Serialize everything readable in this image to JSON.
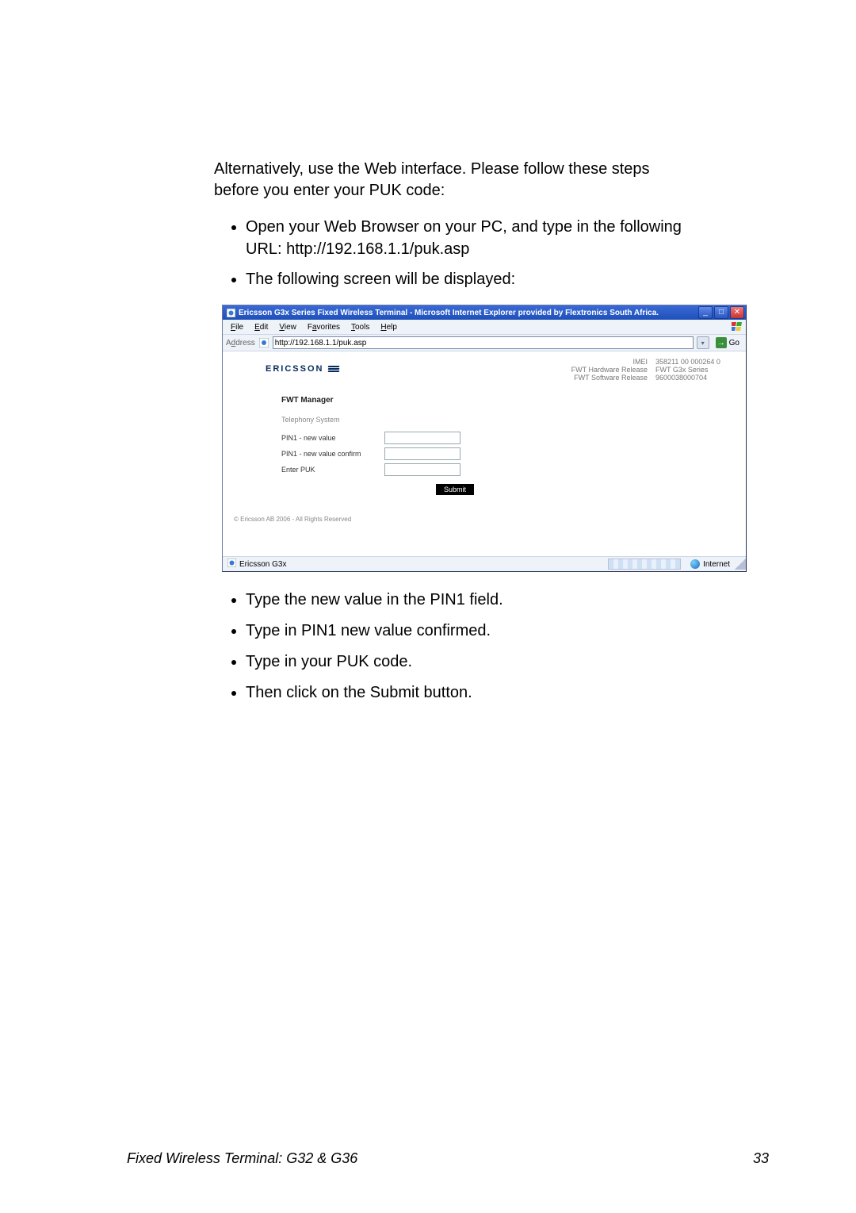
{
  "intro": "Alternatively, use the Web interface.  Please follow these steps before you enter your PUK code:",
  "bullets_before": [
    "Open your Web Browser on your PC, and type in the following URL: http://192.168.1.1/puk.asp",
    "The following screen will be displayed:"
  ],
  "window": {
    "title": "Ericsson G3x Series Fixed Wireless Terminal - Microsoft Internet Explorer provided by Flextronics South Africa.",
    "menus": {
      "file": "File",
      "edit": "Edit",
      "view": "View",
      "favorites": "Favorites",
      "tools": "Tools",
      "help": "Help"
    },
    "address_label": "Address",
    "address_value": "http://192.168.1.1/puk.asp",
    "go_label": "Go",
    "status_left": "Ericsson G3x",
    "status_zone": "Internet"
  },
  "brand": "ERICSSON",
  "device_info": {
    "imei_label": "IMEI",
    "imei_value": "358211 00 000264 0",
    "hw_label": "FWT Hardware Release",
    "hw_value": "FWT G3x Series",
    "sw_label": "FWT Software Release",
    "sw_value": "9600038000704"
  },
  "page_section": {
    "title": "FWT Manager",
    "subtitle": "Telephony System",
    "fields": {
      "pin1": "PIN1 - new value",
      "pin1_confirm": "PIN1 - new value confirm",
      "puk": "Enter PUK"
    },
    "submit": "Submit",
    "copyright": "© Ericsson AB 2006 - All Rights Reserved"
  },
  "bullets_after": [
    "Type the new value in the PIN1 field.",
    "Type in PIN1 new value confirmed.",
    "Type in your PUK code.",
    "Then click on the Submit button."
  ],
  "footer": {
    "left": "Fixed Wireless Terminal: G32 & G36",
    "page": "33"
  }
}
